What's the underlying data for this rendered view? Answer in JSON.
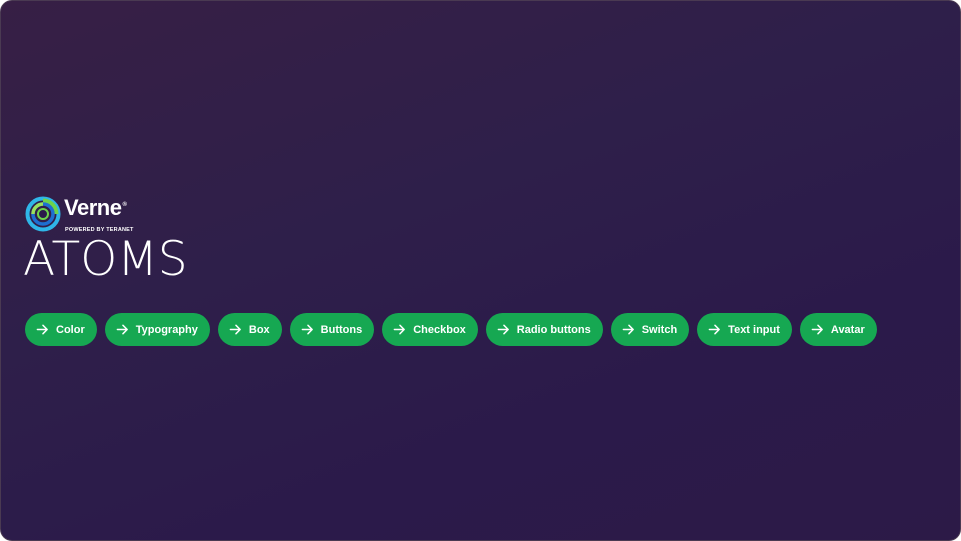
{
  "brand": {
    "name": "Verne",
    "registered": "®",
    "tagline": "POWERED BY TERANET",
    "colors": {
      "ring_outer": "#2fb6e8",
      "ring_mid": "#1e6fd0",
      "ring_inner": "#6dd34b"
    }
  },
  "page": {
    "title": "ATOMS"
  },
  "nav": {
    "icon": "arrow-right-icon",
    "accent": "#16a852",
    "items": [
      {
        "label": "Color"
      },
      {
        "label": "Typography"
      },
      {
        "label": "Box"
      },
      {
        "label": "Buttons"
      },
      {
        "label": "Checkbox"
      },
      {
        "label": "Radio buttons"
      },
      {
        "label": "Switch"
      },
      {
        "label": "Text input"
      },
      {
        "label": "Avatar"
      }
    ]
  }
}
